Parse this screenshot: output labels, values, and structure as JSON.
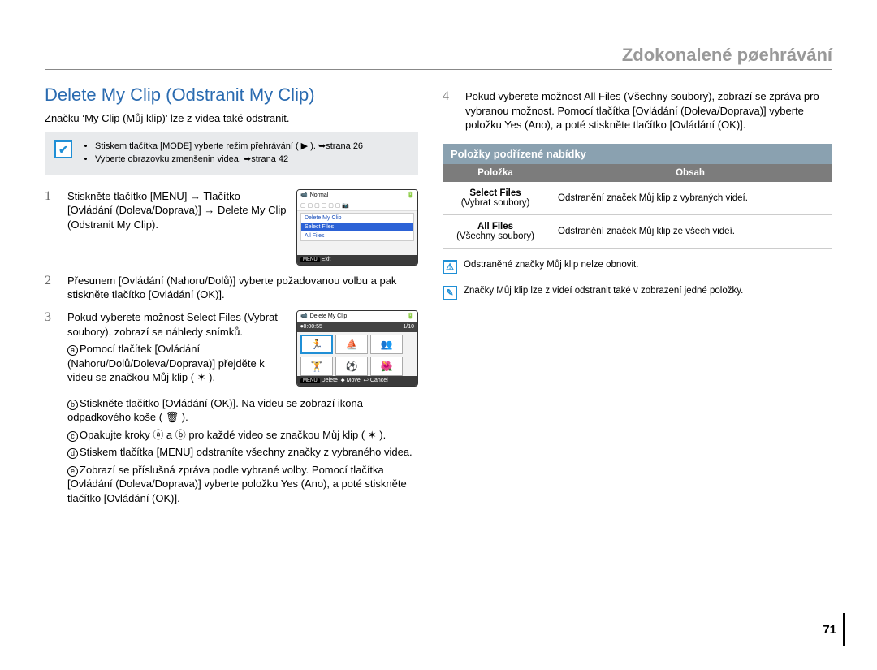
{
  "header": {
    "title": "Zdokonalené pøehrávání"
  },
  "left": {
    "section_title": "Delete My Clip (Odstranit My Clip)",
    "intro": "Značku ‘My Clip (Můj klip)’ lze z videa také odstranit.",
    "gray_tip_1": "Stiskem tlačítka [MODE] vyberte režim přehrávání ( ▶ ). ➥strana 26",
    "gray_tip_2": "Vyberte obrazovku zmenšenin videa. ➥strana 42",
    "step1_pre": "Stiskněte tlačítko [MENU] → Tlačítko [Ovládání (Doleva/Doprava)] → Delete My Clip (Odstranit My Clip).",
    "step2": "Přesunem [Ovládání (Nahoru/Dolů)] vyberte požadovanou volbu a pak stiskněte tlačítko [Ovládání (OK)].",
    "step3": "Pokud vyberete možnost Select Files (Vybrat soubory), zobrazí se náhledy snímků.",
    "sub_a": "Pomocí tlačítek [Ovládání (Nahoru/Dolů/Doleva/Doprava)] přejděte k videu se značkou Můj klip ( ✶ ).",
    "sub_b": "Stiskněte tlačítko [Ovládání (OK)]. Na videu se zobrazí ikona odpadkového koše ( 🗑 ).",
    "sub_c": "Opakujte kroky ⓐ a ⓑ pro každé video se značkou Můj klip ( ✶ ).",
    "sub_d": "Stiskem tlačítka [MENU] odstraníte všechny značky z vybraného videa.",
    "sub_e": "Zobrazí se příslušná zpráva podle vybrané volby. Pomocí tlačítka [Ovládání (Doleva/Doprava)] vyberte položku Yes (Ano), a poté stiskněte tlačítko [Ovládání (OK)].",
    "menu1": {
      "item_normal": "Normal",
      "item_delete": "Delete My Clip",
      "item_select": "Select Files",
      "item_all": "All Files",
      "footer_menu": "MENU",
      "footer_exit": "Exit"
    },
    "menu2": {
      "title": "Delete My Clip",
      "time": "0:00:55",
      "count": "1/10",
      "footer_menu": "MENU",
      "footer_delete": "Delete",
      "footer_move": "Move",
      "footer_cancel": "Cancel"
    }
  },
  "right": {
    "step4_num": "4",
    "step4": "Pokud vyberete možnost All Files (Všechny soubory), zobrazí se zpráva pro vybranou možnost. Pomocí tlačítka [Ovládání (Doleva/Doprava)] vyberte položku Yes (Ano), a poté stiskněte tlačítko [Ovládání (OK)].",
    "sub_header": "Položky podřízené nabídky",
    "table": {
      "hdr1": "Položka",
      "hdr2": "Obsah",
      "r1c1_a": "Select Files",
      "r1c1_b": "(Vybrat soubory)",
      "r1c2": "Odstranění značek Můj klip z vybraných videí.",
      "r2c1_a": "All Files",
      "r2c1_b": "(Všechny soubory)",
      "r2c2": "Odstranění značek Můj klip ze všech videí."
    },
    "note1_icon": "⚠",
    "note1": "Odstraněné značky Můj klip nelze obnovit.",
    "note2_icon": "✎",
    "note2": "Značky Můj klip lze z videí odstranit také v zobrazení jedné položky."
  },
  "page_number": "71"
}
